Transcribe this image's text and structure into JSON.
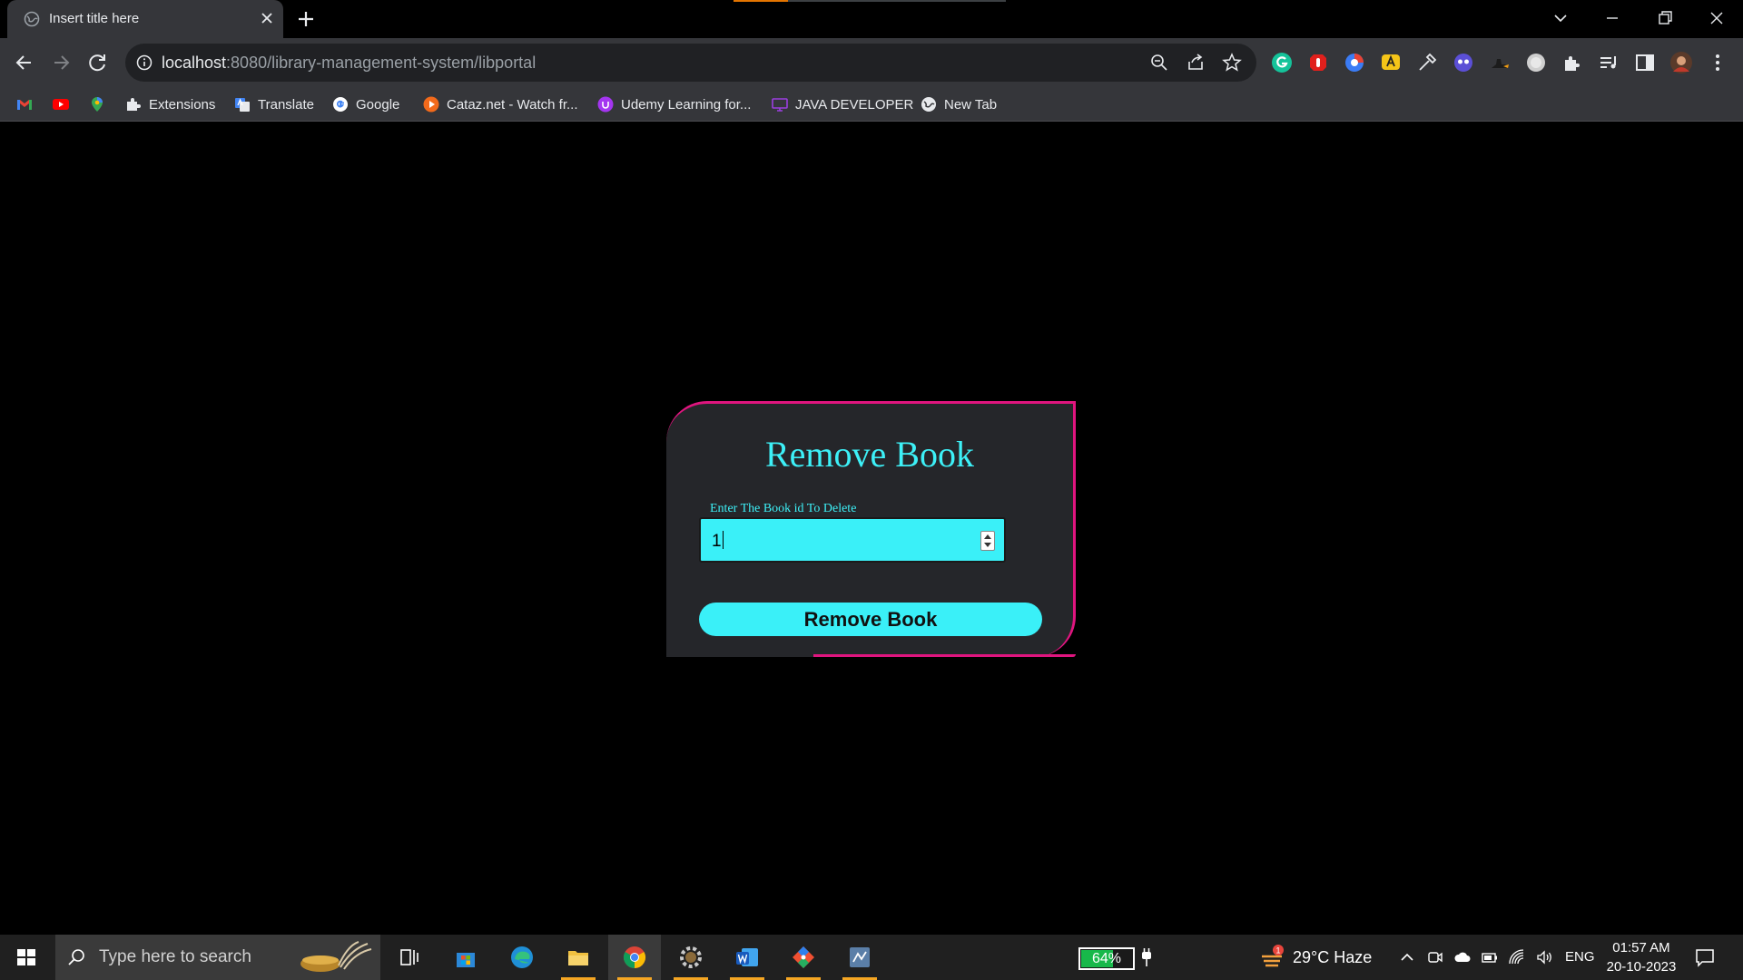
{
  "browser": {
    "tab_title": "Insert title here",
    "url_host": "localhost",
    "url_rest": ":8080/library-management-system/libportal"
  },
  "bookmarks": [
    {
      "icon": "gmail-icon",
      "label": ""
    },
    {
      "icon": "youtube-icon",
      "label": ""
    },
    {
      "icon": "maps-icon",
      "label": ""
    },
    {
      "icon": "puzzle-icon",
      "label": "Extensions"
    },
    {
      "icon": "translate-icon",
      "label": "Translate"
    },
    {
      "icon": "google-icon",
      "label": "Google"
    },
    {
      "icon": "play-icon",
      "label": "Cataz.net - Watch fr..."
    },
    {
      "icon": "udemy-icon",
      "label": "Udemy Learning for..."
    },
    {
      "icon": "monitor-icon",
      "label": "JAVA DEVELOPER"
    },
    {
      "icon": "globe-icon",
      "label": "New Tab"
    }
  ],
  "form": {
    "title": "Remove Book",
    "field_label": "Enter The Book id To Delete",
    "book_id_value": "1",
    "submit_label": "Remove Book"
  },
  "colors": {
    "accent": "#3df0f7",
    "card_border": "#e0157f",
    "card_bg": "#25262a"
  },
  "taskbar": {
    "search_placeholder": "Type here to search",
    "battery_percent_label": "64%",
    "battery_level": 0.64,
    "weather_badge": "1",
    "weather": "29°C  Haze",
    "language": "ENG",
    "time": "01:57 AM",
    "date": "20-10-2023",
    "pinned_apps": [
      "task-view-icon",
      "microsoft-store-icon",
      "edge-icon",
      "file-explorer-icon",
      "chrome-icon",
      "settings-gear-icon",
      "word-icon",
      "git-icon",
      "sts-ide-icon"
    ]
  }
}
